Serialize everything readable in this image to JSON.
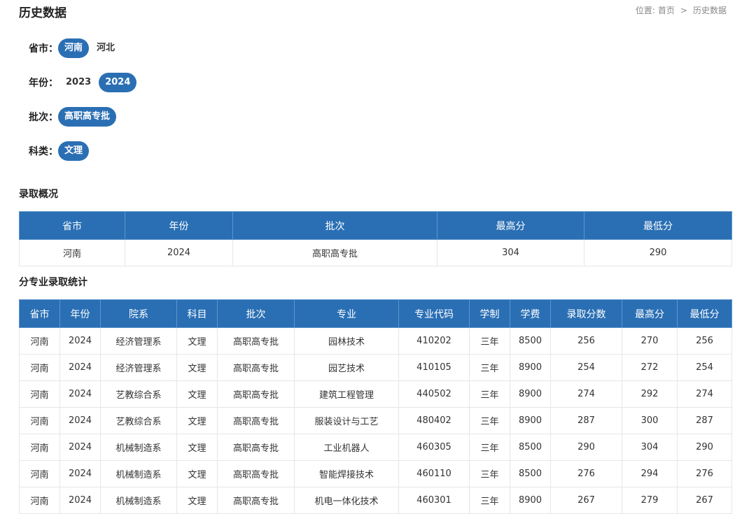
{
  "header": {
    "title": "历史数据",
    "breadcrumb": {
      "prefix": "位置:",
      "home": "首页",
      "separator": ">",
      "current": "历史数据"
    }
  },
  "filters": {
    "province": {
      "label": "省市：",
      "options": [
        "河南",
        "河北"
      ],
      "selected": "河南"
    },
    "year": {
      "label": "年份：",
      "options": [
        "2023",
        "2024"
      ],
      "selected": "2024"
    },
    "batch": {
      "label": "批次：",
      "options": [
        "高职高专批"
      ],
      "selected": "高职高专批"
    },
    "category": {
      "label": "科类：",
      "options": [
        "文理"
      ],
      "selected": "文理"
    }
  },
  "summary": {
    "title": "录取概况",
    "columns": [
      "省市",
      "年份",
      "批次",
      "最高分",
      "最低分"
    ],
    "rows": [
      [
        "河南",
        "2024",
        "高职高专批",
        "304",
        "290"
      ]
    ]
  },
  "majors": {
    "title": "分专业录取统计",
    "columns": [
      "省市",
      "年份",
      "院系",
      "科目",
      "批次",
      "专业",
      "专业代码",
      "学制",
      "学费",
      "录取分数",
      "最高分",
      "最低分"
    ],
    "rows": [
      [
        "河南",
        "2024",
        "经济管理系",
        "文理",
        "高职高专批",
        "园林技术",
        "410202",
        "三年",
        "8500",
        "256",
        "270",
        "256"
      ],
      [
        "河南",
        "2024",
        "经济管理系",
        "文理",
        "高职高专批",
        "园艺技术",
        "410105",
        "三年",
        "8900",
        "254",
        "272",
        "254"
      ],
      [
        "河南",
        "2024",
        "艺教综合系",
        "文理",
        "高职高专批",
        "建筑工程管理",
        "440502",
        "三年",
        "8900",
        "274",
        "292",
        "274"
      ],
      [
        "河南",
        "2024",
        "艺教综合系",
        "文理",
        "高职高专批",
        "服装设计与工艺",
        "480402",
        "三年",
        "8900",
        "287",
        "300",
        "287"
      ],
      [
        "河南",
        "2024",
        "机械制造系",
        "文理",
        "高职高专批",
        "工业机器人",
        "460305",
        "三年",
        "8500",
        "290",
        "304",
        "290"
      ],
      [
        "河南",
        "2024",
        "机械制造系",
        "文理",
        "高职高专批",
        "智能焊接技术",
        "460110",
        "三年",
        "8500",
        "276",
        "294",
        "276"
      ],
      [
        "河南",
        "2024",
        "机械制造系",
        "文理",
        "高职高专批",
        "机电一体化技术",
        "460301",
        "三年",
        "8900",
        "267",
        "279",
        "267"
      ]
    ]
  },
  "colors": {
    "accent": "#2a6fb4"
  }
}
